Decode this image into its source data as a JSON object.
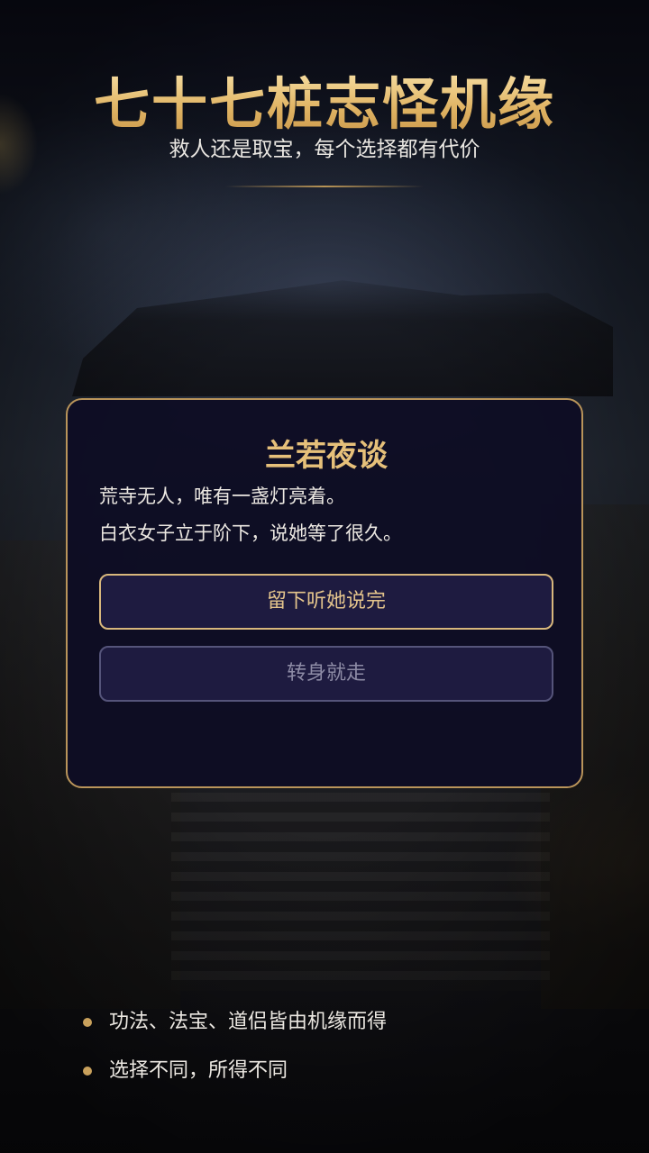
{
  "header": {
    "title": "七十七桩志怪机缘",
    "subtitle": "救人还是取宝，每个选择都有代价"
  },
  "event_card": {
    "title": "兰若夜谈",
    "description_lines": [
      "荒寺无人，唯有一盏灯亮着。",
      "白衣女子立于阶下，说她等了很久。"
    ],
    "choices": [
      {
        "label": "留下听她说完"
      },
      {
        "label": "转身就走"
      }
    ]
  },
  "features": [
    {
      "text": "功法、法宝、道侣皆由机缘而得"
    },
    {
      "text": "选择不同，所得不同"
    }
  ],
  "colors": {
    "accent_gold": "#e0b464",
    "card_background": "#0e0d24",
    "button_background": "#1e1b40"
  }
}
